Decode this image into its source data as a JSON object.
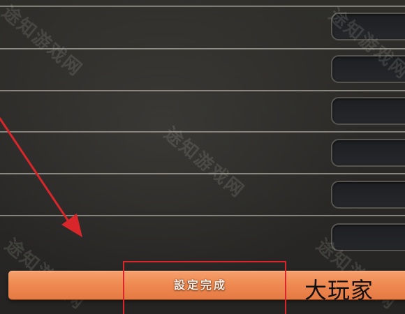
{
  "confirm_button": {
    "label": "設定完成"
  },
  "watermark": {
    "text": "途知游戏网"
  },
  "corner_logo": {
    "text": "大玩家"
  },
  "settings_rows": [
    {
      "value": ""
    },
    {
      "value": ""
    },
    {
      "value": ""
    },
    {
      "value": ""
    },
    {
      "value": ""
    },
    {
      "value": ""
    }
  ],
  "colors": {
    "background": "#2b2a28",
    "divider": "#a8a59d",
    "slot_fill": "#1e1f22",
    "confirm_bar": "#ef8a52",
    "highlight": "#d8262a",
    "arrow": "#d8262a"
  }
}
